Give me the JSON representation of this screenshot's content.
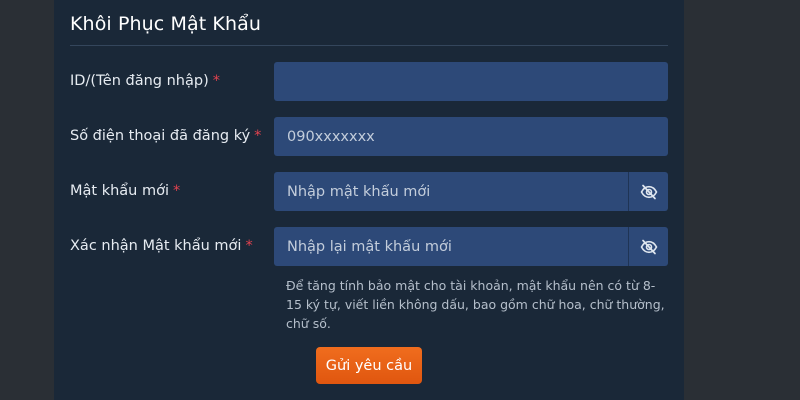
{
  "form": {
    "title": "Khôi Phục Mật Khẩu",
    "required_mark": "*",
    "fields": {
      "username": {
        "label": "ID/(Tên đăng nhập)",
        "value": "",
        "placeholder": ""
      },
      "phone": {
        "label": "Số điện thoại đã đăng ký",
        "value": "",
        "placeholder": "090xxxxxxx"
      },
      "new_password": {
        "label": "Mật khẩu mới",
        "value": "",
        "placeholder": "Nhập mật khẩu mới",
        "toggle_icon": "eye-slash-icon"
      },
      "confirm_password": {
        "label": "Xác nhận Mật khẩu mới",
        "value": "",
        "placeholder": "Nhập lại mật khẩu mới",
        "toggle_icon": "eye-slash-icon"
      }
    },
    "hint": "Để tăng tính bảo mật cho tài khoản, mật khẩu nên có từ 8-15 ký tự, viết liền không dấu, bao gồm chữ hoa, chữ thường, chữ số.",
    "submit_label": "Gửi yêu cầu"
  },
  "colors": {
    "page_background": "#2a2f35",
    "panel_background": "#1a2838",
    "input_background": "#2d4978",
    "required_mark": "#e3434f",
    "submit_button": "#ee6a1b"
  }
}
